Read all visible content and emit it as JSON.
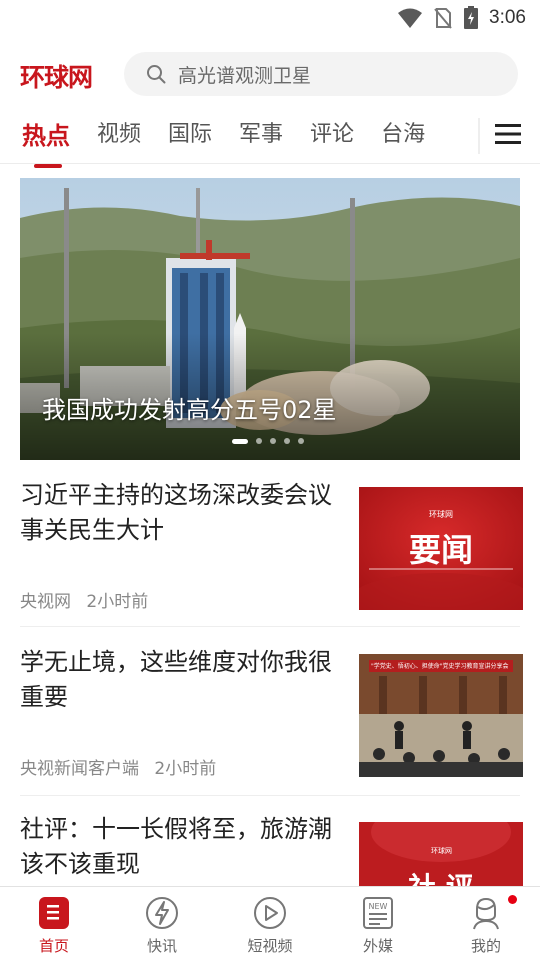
{
  "status_bar": {
    "time": "3:06",
    "icons": [
      "wifi-icon",
      "no-sim-icon",
      "battery-charging-icon"
    ]
  },
  "header": {
    "logo": "环球网",
    "search_placeholder": "高光谱观测卫星"
  },
  "tabs": [
    {
      "label": "热点",
      "active": true
    },
    {
      "label": "视频"
    },
    {
      "label": "国际"
    },
    {
      "label": "军事"
    },
    {
      "label": "评论"
    },
    {
      "label": "台海"
    }
  ],
  "banner": {
    "caption": "我国成功发射高分五号02星",
    "slide_count": 5,
    "active_slide": 1
  },
  "news": [
    {
      "title": "习近平主持的这场深改委会议 事关民生大计",
      "source": "央视网",
      "time": "2小时前",
      "thumb_text": "要闻",
      "thumb_logo": "环球网"
    },
    {
      "title": "学无止境，这些维度对你我很重要",
      "source": "央视新闻客户端",
      "time": "2小时前",
      "thumb_banner": "\"学党史、悟初心、担使命\"党史学习教育宣讲分享会"
    },
    {
      "title": "社评：十一长假将至，旅游潮该不该重现",
      "thumb_text": "社 评",
      "thumb_logo": "环球网"
    }
  ],
  "bottom_nav": [
    {
      "label": "首页",
      "icon": "home-icon",
      "active": true
    },
    {
      "label": "快讯",
      "icon": "lightning-icon"
    },
    {
      "label": "短视频",
      "icon": "play-icon"
    },
    {
      "label": "外媒",
      "icon": "newspaper-icon"
    },
    {
      "label": "我的",
      "icon": "profile-icon",
      "badge": true
    }
  ],
  "colors": {
    "accent": "#c8161d",
    "badge": "#e60012",
    "text_primary": "#222222",
    "text_meta": "#888888"
  }
}
